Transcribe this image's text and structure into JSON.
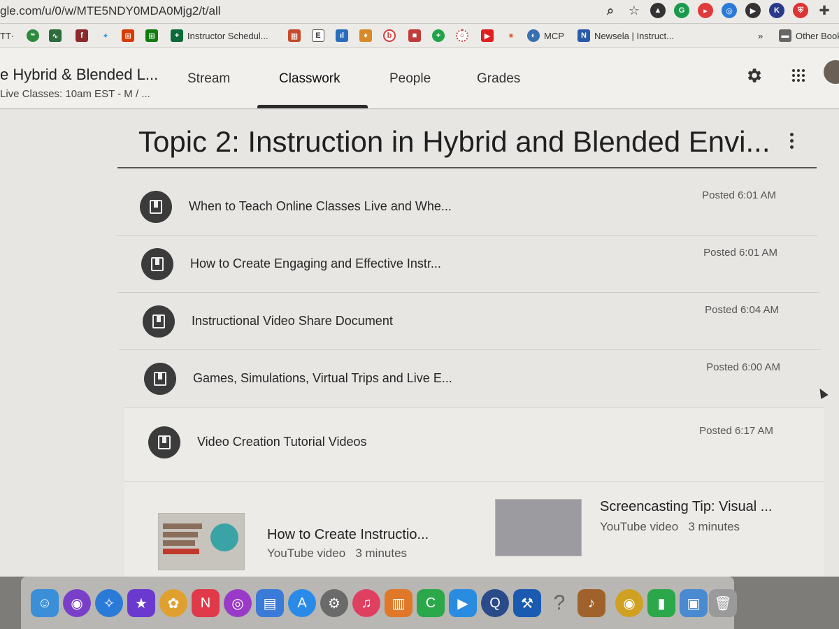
{
  "browser": {
    "url": "gle.com/u/0/w/MTE5NDY0MDA0Mjg2/t/all",
    "bookmarks": [
      {
        "label": "TT·",
        "icon": "bookmark-icon",
        "color": "#555555"
      },
      {
        "label": "",
        "icon": "hangouts-icon",
        "color": "#2e8b3d"
      },
      {
        "label": "",
        "icon": "chart-icon",
        "color": "#2e6b3d"
      },
      {
        "label": "",
        "icon": "app-icon",
        "color": "#8b2a2a"
      },
      {
        "label": "",
        "icon": "twitter-icon",
        "color": "#1d9bf0"
      },
      {
        "label": "",
        "icon": "windows-icon",
        "color": "#d83b01"
      },
      {
        "label": "",
        "icon": "windows-icon",
        "color": "#107c10"
      },
      {
        "label": "Instructor Schedul...",
        "icon": "plus-icon",
        "color": "#0b6b3a"
      },
      {
        "label": "",
        "icon": "game-icon",
        "color": "#c44c2c"
      },
      {
        "label": "",
        "icon": "e-icon",
        "color": "#555555"
      },
      {
        "label": "",
        "icon": "analytics-icon",
        "color": "#2a6ebb"
      },
      {
        "label": "",
        "icon": "badge-icon",
        "color": "#d68a2a"
      },
      {
        "label": "",
        "icon": "b-icon",
        "color": "#d33c3c"
      },
      {
        "label": "",
        "icon": "square-icon",
        "color": "#c23b3b"
      },
      {
        "label": "",
        "icon": "plus-circle-icon",
        "color": "#22a34a"
      },
      {
        "label": "",
        "icon": "lifebuoy-icon",
        "color": "#d04040"
      },
      {
        "label": "",
        "icon": "youtube-icon",
        "color": "#e02020"
      },
      {
        "label": "",
        "icon": "star-icon",
        "color": "#e05a2a"
      },
      {
        "label": "MCP",
        "icon": "headset-icon",
        "color": "#3a6fb0"
      },
      {
        "label": "Newsela | Instruct...",
        "icon": "newsela-icon",
        "color": "#2a5aa8"
      },
      {
        "label": "»",
        "icon": "",
        "color": ""
      },
      {
        "label": "Other Book",
        "icon": "folder-icon",
        "color": "#666666"
      }
    ],
    "extensions": [
      "zoom-icon",
      "bookmark-star-icon",
      "drive-icon",
      "grammarly-icon",
      "screencastify-icon",
      "compass-icon",
      "play-icon",
      "k-icon",
      "shield-icon",
      "puzzle-icon"
    ]
  },
  "classroom": {
    "class_title": "e Hybrid & Blended L...",
    "class_subtitle": "Live Classes: 10am EST - M / ...",
    "tabs": [
      "Stream",
      "Classwork",
      "People",
      "Grades"
    ],
    "active_tab": "Classwork"
  },
  "topic": {
    "title": "Topic 2: Instruction in Hybrid and Blended Envi...",
    "items": [
      {
        "title": "When to Teach Online Classes Live and Whe...",
        "posted": "Posted 6:01 AM"
      },
      {
        "title": "How to Create Engaging and Effective Instr...",
        "posted": "Posted 6:01 AM"
      },
      {
        "title": "Instructional Video Share Document",
        "posted": "Posted 6:04 AM"
      },
      {
        "title": "Games, Simulations, Virtual Trips and Live E...",
        "posted": "Posted 6:00 AM"
      },
      {
        "title": "Video Creation Tutorial Videos",
        "posted": "Posted 6:17 AM"
      }
    ],
    "attachments": [
      {
        "title": "How to Create Instructio...",
        "type": "YouTube video",
        "duration": "3 minutes"
      },
      {
        "title": "Screencasting Tip: Visual ...",
        "type": "YouTube video",
        "duration": "3 minutes"
      }
    ]
  },
  "dock": [
    {
      "name": "finder-icon",
      "color": "#3a8fd8"
    },
    {
      "name": "siri-icon",
      "color": "#7a3fc9"
    },
    {
      "name": "safari-icon",
      "color": "#2a7ad8"
    },
    {
      "name": "imovie-icon",
      "color": "#6a3ad0"
    },
    {
      "name": "photos-icon",
      "color": "#e0a030"
    },
    {
      "name": "news-icon",
      "color": "#e03a4a"
    },
    {
      "name": "podcasts-icon",
      "color": "#9a3ac8"
    },
    {
      "name": "keynote-icon",
      "color": "#3a7ad8"
    },
    {
      "name": "app-store-icon",
      "color": "#2a8ae8"
    },
    {
      "name": "system-preferences-icon",
      "color": "#6a6a6a"
    },
    {
      "name": "music-icon",
      "color": "#e04060"
    },
    {
      "name": "books-icon",
      "color": "#e0782a"
    },
    {
      "name": "classroom-c-icon",
      "color": "#2aa84a"
    },
    {
      "name": "zoom-icon",
      "color": "#2a8ce0"
    },
    {
      "name": "quicktime-icon",
      "color": "#2a4a8a"
    },
    {
      "name": "xcode-icon",
      "color": "#1a5ab0"
    },
    {
      "name": "help-icon",
      "color": "#8a8a8a"
    },
    {
      "name": "guitar-icon",
      "color": "#a0622a"
    },
    {
      "name": "chrome-icon",
      "color": "#d0a020"
    },
    {
      "name": "numbers-icon",
      "color": "#2aa84a"
    },
    {
      "name": "preview-icon",
      "color": "#4a8ad0"
    },
    {
      "name": "trash-icon",
      "color": "#9a9a9a"
    }
  ]
}
